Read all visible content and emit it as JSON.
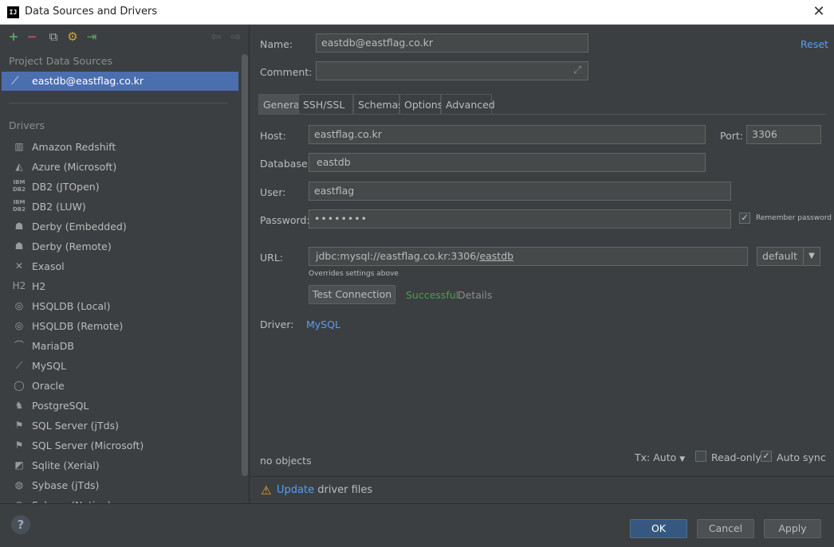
{
  "window": {
    "title": "Data Sources and Drivers",
    "app_icon_text": "IJ"
  },
  "toolbar": {
    "add": "+",
    "remove": "−",
    "copy": "⧉",
    "settings": "⚙",
    "import": "⇥",
    "back": "⇦",
    "forward": "⇨"
  },
  "project": {
    "title": "Project Data Sources",
    "items": [
      {
        "label": "eastdb@eastflag.co.kr",
        "icon": "dolphin-icon"
      }
    ]
  },
  "drivers": {
    "title": "Drivers",
    "items": [
      {
        "label": "Amazon Redshift",
        "icon": "redshift-icon",
        "glyph": "▥"
      },
      {
        "label": "Azure (Microsoft)",
        "icon": "azure-icon",
        "glyph": "◭"
      },
      {
        "label": "DB2 (JTOpen)",
        "icon": "db2-icon",
        "glyph": "IBM DB2"
      },
      {
        "label": "DB2 (LUW)",
        "icon": "db2-icon",
        "glyph": "IBM DB2"
      },
      {
        "label": "Derby (Embedded)",
        "icon": "derby-hat-icon",
        "glyph": "☗"
      },
      {
        "label": "Derby (Remote)",
        "icon": "derby-hat-icon",
        "glyph": "☗"
      },
      {
        "label": "Exasol",
        "icon": "exasol-icon",
        "glyph": "✕"
      },
      {
        "label": "H2",
        "icon": "h2-icon",
        "glyph": "H2"
      },
      {
        "label": "HSQLDB (Local)",
        "icon": "hsqldb-icon",
        "glyph": "◎"
      },
      {
        "label": "HSQLDB (Remote)",
        "icon": "hsqldb-icon",
        "glyph": "◎"
      },
      {
        "label": "MariaDB",
        "icon": "mariadb-seal-icon",
        "glyph": "⌒"
      },
      {
        "label": "MySQL",
        "icon": "mysql-dolphin-icon",
        "glyph": "⟋"
      },
      {
        "label": "Oracle",
        "icon": "oracle-icon",
        "glyph": "◯"
      },
      {
        "label": "PostgreSQL",
        "icon": "postgresql-elephant-icon",
        "glyph": "♞"
      },
      {
        "label": "SQL Server (jTds)",
        "icon": "sqlserver-icon",
        "glyph": "⚑"
      },
      {
        "label": "SQL Server (Microsoft)",
        "icon": "sqlserver-icon",
        "glyph": "⚑"
      },
      {
        "label": "Sqlite (Xerial)",
        "icon": "sqlite-feather-icon",
        "glyph": "◩"
      },
      {
        "label": "Sybase (jTds)",
        "icon": "sybase-icon",
        "glyph": "◍"
      },
      {
        "label": "Sybase (Native)",
        "icon": "sybase-icon",
        "glyph": "◍"
      }
    ]
  },
  "form": {
    "name_label": "Name:",
    "name_value": "eastdb@eastflag.co.kr",
    "comment_label": "Comment:",
    "comment_value": "",
    "reset": "Reset",
    "tabs": [
      "General",
      "SSH/SSL",
      "Schemas",
      "Options",
      "Advanced"
    ],
    "host_label": "Host:",
    "host_value": "eastflag.co.kr",
    "port_label": "Port:",
    "port_value": "3306",
    "database_label": "Database:",
    "database_value": "eastdb",
    "user_label": "User:",
    "user_value": "eastflag",
    "password_label": "Password:",
    "password_value": "••••••••",
    "remember_password": "Remember password",
    "url_label": "URL:",
    "url_prefix": "jdbc:mysql://eastflag.co.kr:3306/",
    "url_db": "eastdb",
    "url_mode": "default",
    "url_hint": "Overrides settings above",
    "test_connection": "Test Connection",
    "test_status": "Successful",
    "details": "Details",
    "driver_label": "Driver:",
    "driver_value": "MySQL"
  },
  "footer": {
    "objects": "no objects",
    "tx_label": "Tx: Auto",
    "read_only": "Read-only",
    "auto_sync": "Auto sync",
    "update_link": "Update",
    "update_text": "driver files"
  },
  "buttons": {
    "ok": "OK",
    "cancel": "Cancel",
    "apply": "Apply",
    "help": "?"
  },
  "colors": {
    "accent": "#4b6eaf",
    "link": "#589df6",
    "success": "#499c54",
    "warning": "#f0a732"
  }
}
